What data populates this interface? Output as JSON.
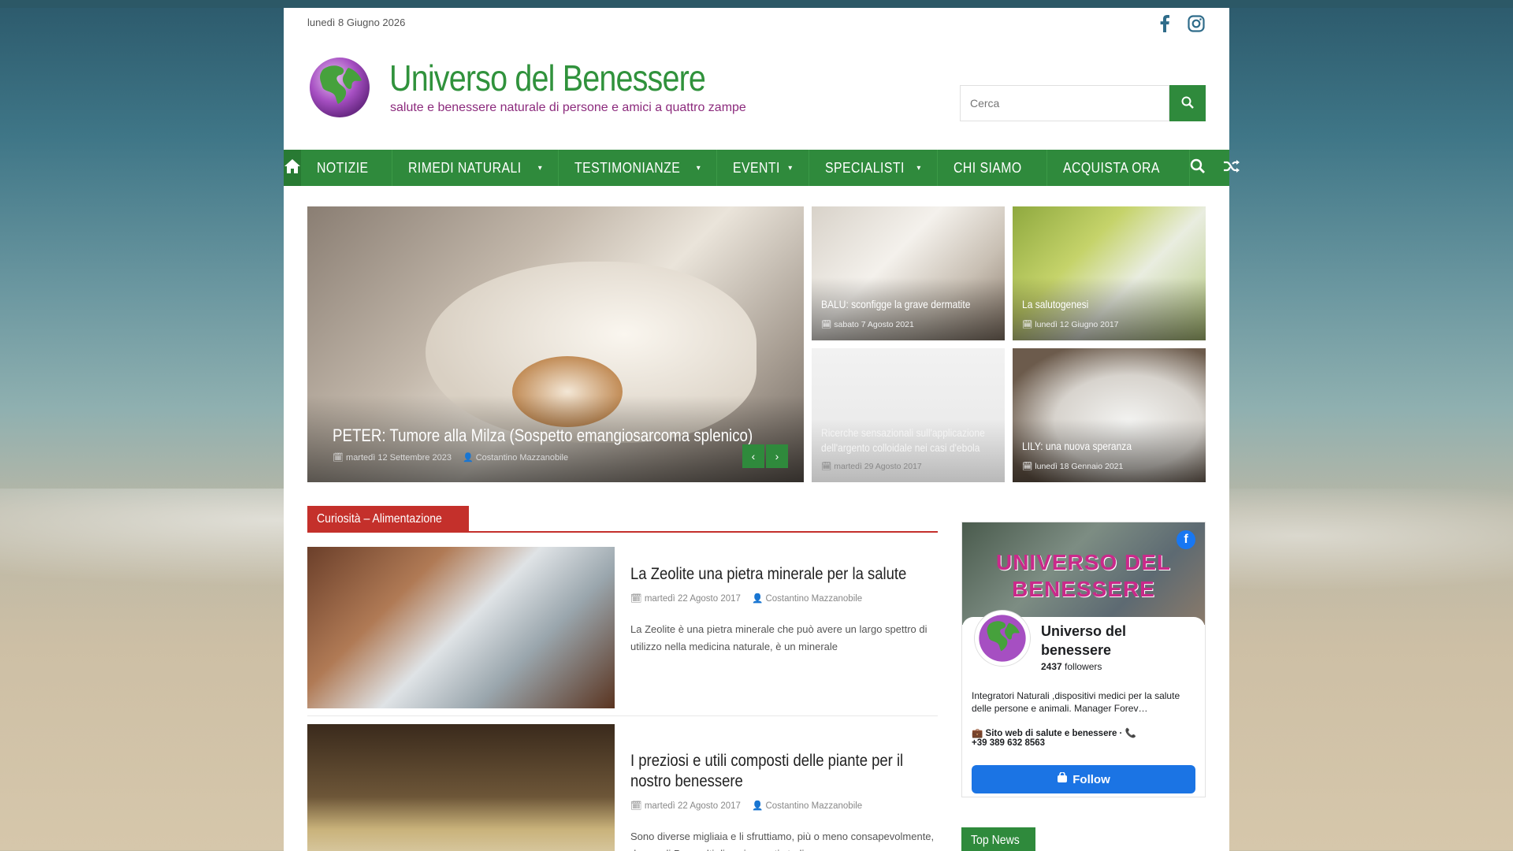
{
  "topbar": {
    "date": "lunedì 8 Giugno 2026"
  },
  "header": {
    "title": "Universo del Benessere",
    "tagline": "salute e benessere naturale di persone e amici a quattro zampe",
    "search_placeholder": "Cerca"
  },
  "nav": {
    "items": [
      {
        "label": "NOTIZIE",
        "caret": ""
      },
      {
        "label": "RIMEDI NATURALI",
        "caret": "▾"
      },
      {
        "label": "TESTIMONIANZE",
        "caret": "▾"
      },
      {
        "label": "EVENTI",
        "caret": "▾"
      },
      {
        "label": "SPECIALISTI",
        "caret": "▾"
      },
      {
        "label": "CHI SIAMO",
        "caret": ""
      },
      {
        "label": "ACQUISTA ORA",
        "caret": ""
      }
    ]
  },
  "slider": {
    "title": "PETER: Tumore alla Milza (Sospetto emangiosarcoma splenico)",
    "date": "martedì 12 Settembre 2023",
    "author": "Costantino Mazzanobile",
    "prev": "‹",
    "next": "›"
  },
  "tiles": [
    {
      "title": "BALU: sconfigge la grave dermatite",
      "date": "sabato 7 Agosto 2021"
    },
    {
      "title": "La salutogenesi",
      "date": "lunedì 12 Giugno 2017"
    },
    {
      "title": "Ricerche sensazionali sull'applicazione dell'argento colloidale nei casi d'ebola",
      "date": "martedì 29 Agosto 2017"
    },
    {
      "title": "LILY: una nuova speranza",
      "date": "lunedì 18 Gennaio 2021"
    }
  ],
  "section": {
    "title": "Curiosità – Alimentazione"
  },
  "articles": [
    {
      "title": "La Zeolite una pietra minerale per la salute",
      "date": "martedì 22 Agosto 2017",
      "author": "Costantino Mazzanobile",
      "excerpt": "La Zeolite è una pietra minerale che può avere un largo spettro di utilizzo nella medicina naturale, è un minerale"
    },
    {
      "title": "I preziosi e utili composti delle piante per il nostro benessere",
      "date": "martedì 22 Agosto 2017",
      "author": "Costantino Mazzanobile",
      "excerpt": "Sono diverse migliaia e li sfruttiamo, più o meno consapevolmente, da secoli.Per molti di essi recenti studi"
    }
  ],
  "facebook": {
    "cover_text": "UNIVERSO DEL BENESSERE",
    "page_name": "Universo del benessere",
    "followers_count": "2437",
    "followers_label": "followers",
    "description": "Integratori Naturali ,dispositivi medici per la salute delle persone e animali. Manager Forev…",
    "website_label": "Sito web di salute e benessere",
    "phone": "+39 389 632 8563",
    "follow_label": "Follow"
  },
  "sidebar": {
    "top_news": "Top News"
  },
  "icons": {
    "home": "home-icon",
    "search": "search-icon",
    "shuffle": "shuffle-icon",
    "calendar": "calendar-icon",
    "user": "user-icon",
    "facebook": "facebook-icon",
    "instagram": "instagram-icon"
  },
  "colors": {
    "brand_green": "#2f8a3c",
    "tagline_purple": "#8c2b7d",
    "section_red": "#c4302b",
    "facebook_blue": "#1b74e4"
  }
}
